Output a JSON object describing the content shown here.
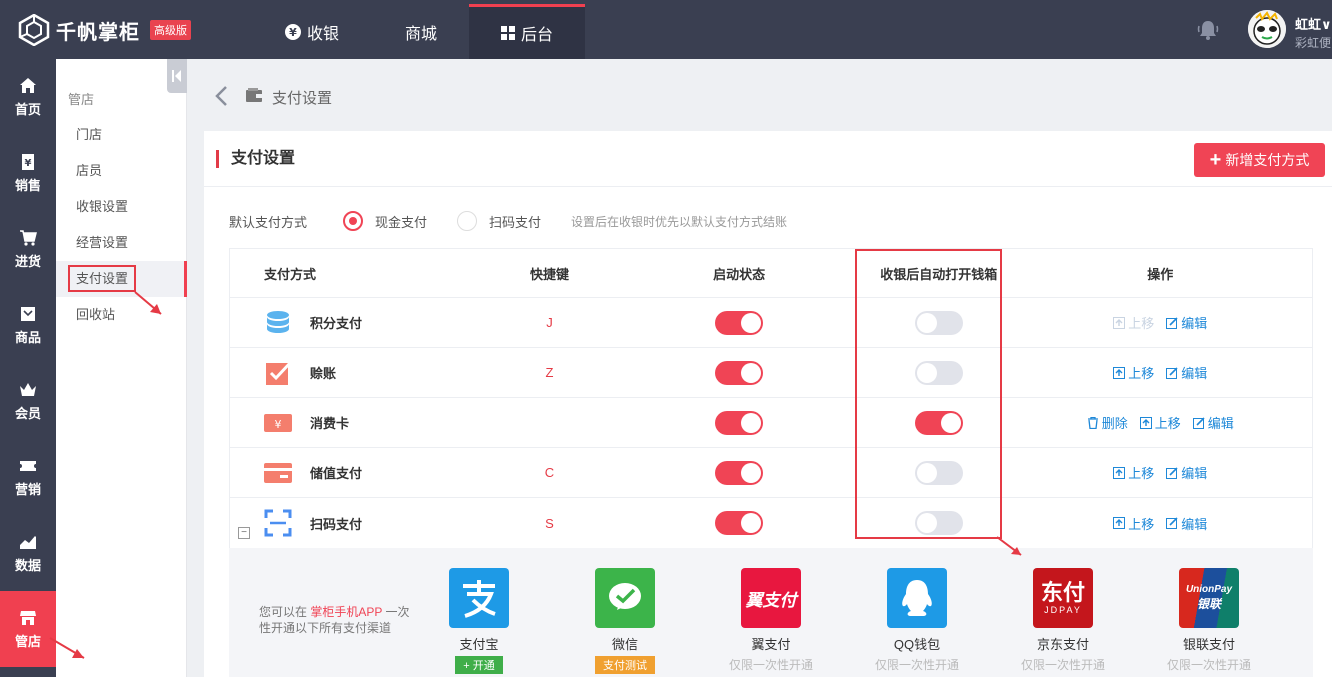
{
  "app": {
    "logo_text": "千帆掌柜",
    "edition": "高级版"
  },
  "topnav": [
    {
      "label": "收银"
    },
    {
      "label": "商城"
    },
    {
      "label": "后台"
    }
  ],
  "user": {
    "name": "虹虹∨",
    "brand": "彩虹便"
  },
  "rail": [
    {
      "label": "首页"
    },
    {
      "label": "销售"
    },
    {
      "label": "进货"
    },
    {
      "label": "商品"
    },
    {
      "label": "会员"
    },
    {
      "label": "营销"
    },
    {
      "label": "数据"
    },
    {
      "label": "管店"
    }
  ],
  "submenu": {
    "title": "管店",
    "items": [
      {
        "label": "门店"
      },
      {
        "label": "店员"
      },
      {
        "label": "收银设置"
      },
      {
        "label": "经营设置"
      },
      {
        "label": "支付设置"
      },
      {
        "label": "回收站"
      }
    ]
  },
  "breadcrumb": {
    "current": "支付设置"
  },
  "panel": {
    "title": "支付设置",
    "add_button": "新增支付方式",
    "default_label": "默认支付方式",
    "option_cash": "现金支付",
    "option_scan": "扫码支付",
    "hint": "设置后在收银时优先以默认支付方式结账"
  },
  "table": {
    "headers": [
      "支付方式",
      "快捷键",
      "启动状态",
      "收银后自动打开钱箱",
      "操作"
    ],
    "rows": [
      {
        "name": "积分支付",
        "key": "J",
        "enabled": true,
        "drawer": false
      },
      {
        "name": "赊账",
        "key": "Z",
        "enabled": true,
        "drawer": false
      },
      {
        "name": "消费卡",
        "key": "",
        "enabled": true,
        "drawer": true
      },
      {
        "name": "储值支付",
        "key": "C",
        "enabled": true,
        "drawer": false
      },
      {
        "name": "扫码支付",
        "key": "S",
        "enabled": true,
        "drawer": false
      }
    ],
    "ops": {
      "delete": "删除",
      "up": "上移",
      "edit": "编辑"
    }
  },
  "channels": {
    "note_prefix": "您可以在",
    "note_link": "掌柜手机APP",
    "note_suffix": "一次性开通以下所有支付渠道",
    "items": [
      {
        "name": "支付宝",
        "tag": "+ 开通",
        "tag_color": "#3fae49"
      },
      {
        "name": "微信",
        "tag": "支付测试",
        "tag_color": "#f0a030"
      },
      {
        "name": "翼支付",
        "sub": "仅限一次性开通"
      },
      {
        "name": "QQ钱包",
        "sub": "仅限一次性开通"
      },
      {
        "name": "京东支付",
        "sub": "仅限一次性开通"
      },
      {
        "name": "银联支付",
        "sub": "仅限一次性开通"
      }
    ],
    "logo_text": {
      "yi": "翼支付",
      "jd_top": "东付",
      "jd_bottom": "JDPAY",
      "up_top": "UnionPay",
      "up_bottom": "银联"
    }
  },
  "colors": {
    "accent": "#f04455",
    "link": "#1e88d8",
    "sidebar": "#3a3f51"
  }
}
